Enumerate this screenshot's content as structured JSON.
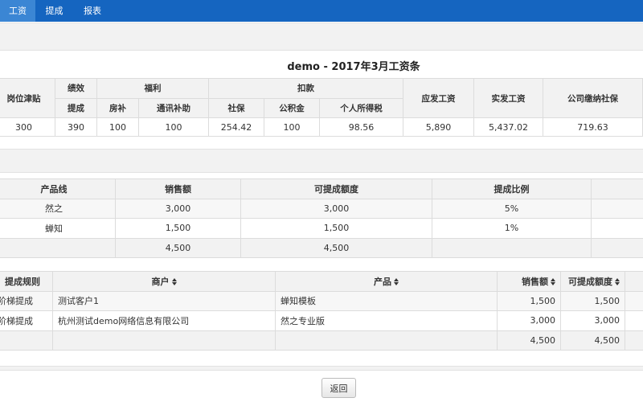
{
  "nav": {
    "tabs": [
      {
        "label": "工资",
        "active": true
      },
      {
        "label": "提成",
        "active": false
      },
      {
        "label": "报表",
        "active": false
      }
    ],
    "bar_color": "#1565c0",
    "active_color": "#3b86d4"
  },
  "payslip": {
    "title": "demo - 2017年3月工资条",
    "headers": {
      "position_allowance": "岗位津贴",
      "performance": "绩效",
      "commission": "提成",
      "welfare": "福利",
      "housing": "房补",
      "telecom": "通讯补助",
      "deductions": "扣款",
      "social_security": "社保",
      "housing_fund": "公积金",
      "income_tax": "个人所得税",
      "gross_pay": "应发工资",
      "net_pay": "实发工资",
      "company_social": "公司缴纳社保"
    },
    "row": {
      "position_allowance": "300",
      "commission": "390",
      "housing": "100",
      "telecom": "100",
      "social_security": "254.42",
      "housing_fund": "100",
      "income_tax": "98.56",
      "gross_pay": "5,890",
      "net_pay": "5,437.02",
      "company_social": "719.63"
    }
  },
  "products": {
    "headers": {
      "line": "产品线",
      "sales": "销售额",
      "commissionable": "可提成额度",
      "ratio": "提成比例"
    },
    "rows": [
      {
        "line": "然之",
        "sales": "3,000",
        "commissionable": "3,000",
        "ratio": "5%"
      },
      {
        "line": "蝉知",
        "sales": "1,500",
        "commissionable": "1,500",
        "ratio": "1%"
      }
    ],
    "total": {
      "sales": "4,500",
      "commissionable": "4,500"
    }
  },
  "rules": {
    "headers": {
      "rule": "提成规则",
      "merchant": "商户",
      "product": "产品",
      "sales": "销售额",
      "commissionable": "可提成额度"
    },
    "rows": [
      {
        "rule": "阶梯提成",
        "merchant": "测试客户1",
        "product": "蝉知模板",
        "sales": "1,500",
        "commissionable": "1,500"
      },
      {
        "rule": "阶梯提成",
        "merchant": "杭州测试demo网络信息有限公司",
        "product": "然之专业版",
        "sales": "3,000",
        "commissionable": "3,000"
      }
    ],
    "total": {
      "sales": "4,500",
      "commissionable": "4,500"
    }
  },
  "actions": {
    "back_label": "返回"
  }
}
